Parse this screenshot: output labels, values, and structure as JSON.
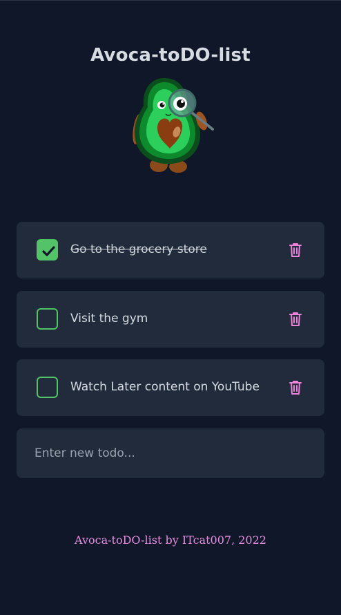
{
  "app": {
    "title": "Avoca-toDO-list"
  },
  "todos": [
    {
      "label": "Go to the grocery store",
      "done": true
    },
    {
      "label": "Visit the gym",
      "done": false
    },
    {
      "label": "Watch Later content on YouTube",
      "done": false
    }
  ],
  "new_todo": {
    "placeholder": "Enter new todo...",
    "value": ""
  },
  "footer": {
    "text": "Avoca-toDO-list by ITcat007, 2022"
  },
  "icons": {
    "check": "check-icon",
    "delete": "trash-icon",
    "mascot": "avocado-with-magnifying-glass"
  },
  "colors": {
    "background": "#0f1729",
    "card": "#222b3c",
    "accent_green": "#52c366",
    "delete_pink": "#ef82d9",
    "footer_pink": "#e68ee0",
    "text": "#d6dbe3"
  }
}
